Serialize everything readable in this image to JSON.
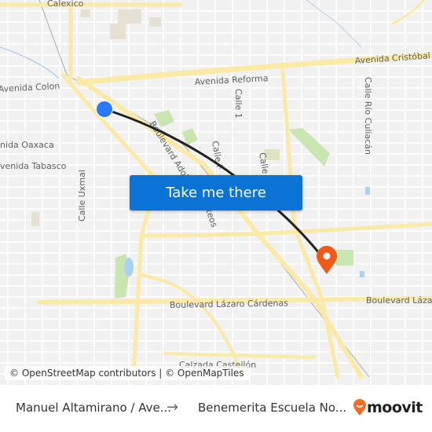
{
  "map": {
    "labels": {
      "calexico": "Calexico",
      "avenida_colon": "Avenida Colon",
      "avenida_reforma": "Avenida Reforma",
      "avenida_cristobal": "Avenida Cristóbal C",
      "calle_1": "Calle 1",
      "calle_rio_culiacan": "Calle Río Culiacán",
      "avenida_oaxaca": "nida Oaxaca",
      "avenida_tabasco": "venida Tabasco",
      "calle_uxmal": "Calle Uxmal",
      "boulevard_adolfo": "Boulevard Adolfo",
      "boulevard_adolfo_end": "teos",
      "calle_f": "Calle F",
      "calle_e": "Calle",
      "boulevard_lazaro": "Boulevard Lázaro Cárdenas",
      "boulevard_lazaro_right": "Boulevard Lázaro",
      "calzada_castellon": "Calzada Castellón"
    },
    "colors": {
      "background": "#f1f1f1",
      "major_road": "#fbe9a6",
      "minor_road": "#ffffff",
      "park": "#c9e6b0",
      "water": "#a9d3f2",
      "route_line": "#222222",
      "origin_marker": "#2979ff",
      "destination_marker": "#f05a16"
    },
    "attribution": "© OpenStreetMap contributors | © OpenMapTiles"
  },
  "cta": {
    "label": "Take me there",
    "color": "#0b73d6"
  },
  "footer": {
    "origin": "Manuel Altamirano / Ave...",
    "arrow": "→",
    "destination": "Benemerita Escuela No...",
    "brand": "moovit",
    "brand_color": "#f36b21"
  }
}
